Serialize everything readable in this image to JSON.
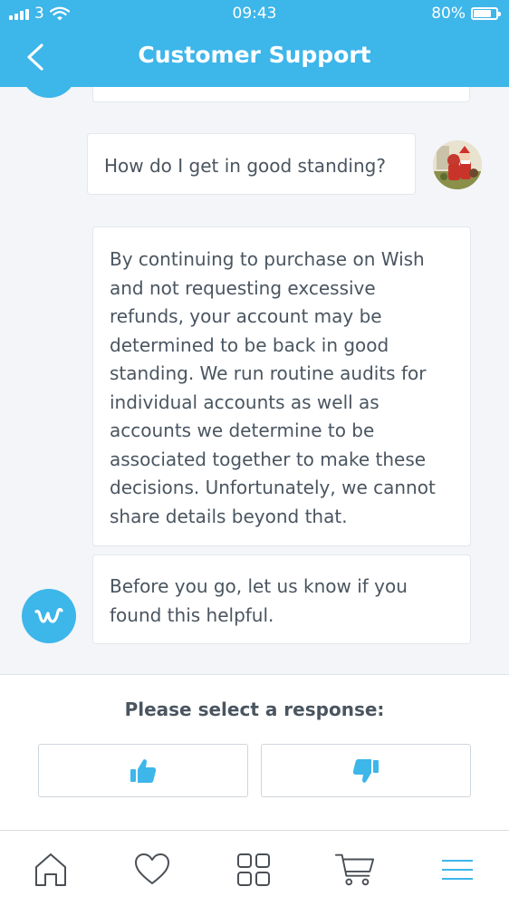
{
  "status_bar": {
    "carrier": "3",
    "time": "09:43",
    "battery": "80%",
    "battery_level": 0.8
  },
  "header": {
    "title": "Customer Support",
    "back_icon": "chevron-left-icon"
  },
  "conversation": {
    "user_message": "How do I get in good standing?",
    "support_reply": "By continuing to purchase on Wish and not requesting excessive refunds, your account may be determined to be back in good standing. We run routine audits for individual accounts as well as accounts we determine to be associated together to make these decisions. Unfortunately, we cannot share details beyond that.",
    "support_followup": "Before you go, let us know if you found this helpful."
  },
  "response": {
    "prompt": "Please select a response:",
    "thumbs_up_icon": "thumbs-up-icon",
    "thumbs_down_icon": "thumbs-down-icon"
  },
  "tabbar": {
    "items": [
      "home-icon",
      "heart-icon",
      "grid-icon",
      "cart-icon",
      "menu-icon"
    ],
    "active_color": "#3db6ea"
  },
  "colors": {
    "brand": "#3db6ea",
    "text": "#4a5560",
    "background": "#f3f5f8"
  }
}
